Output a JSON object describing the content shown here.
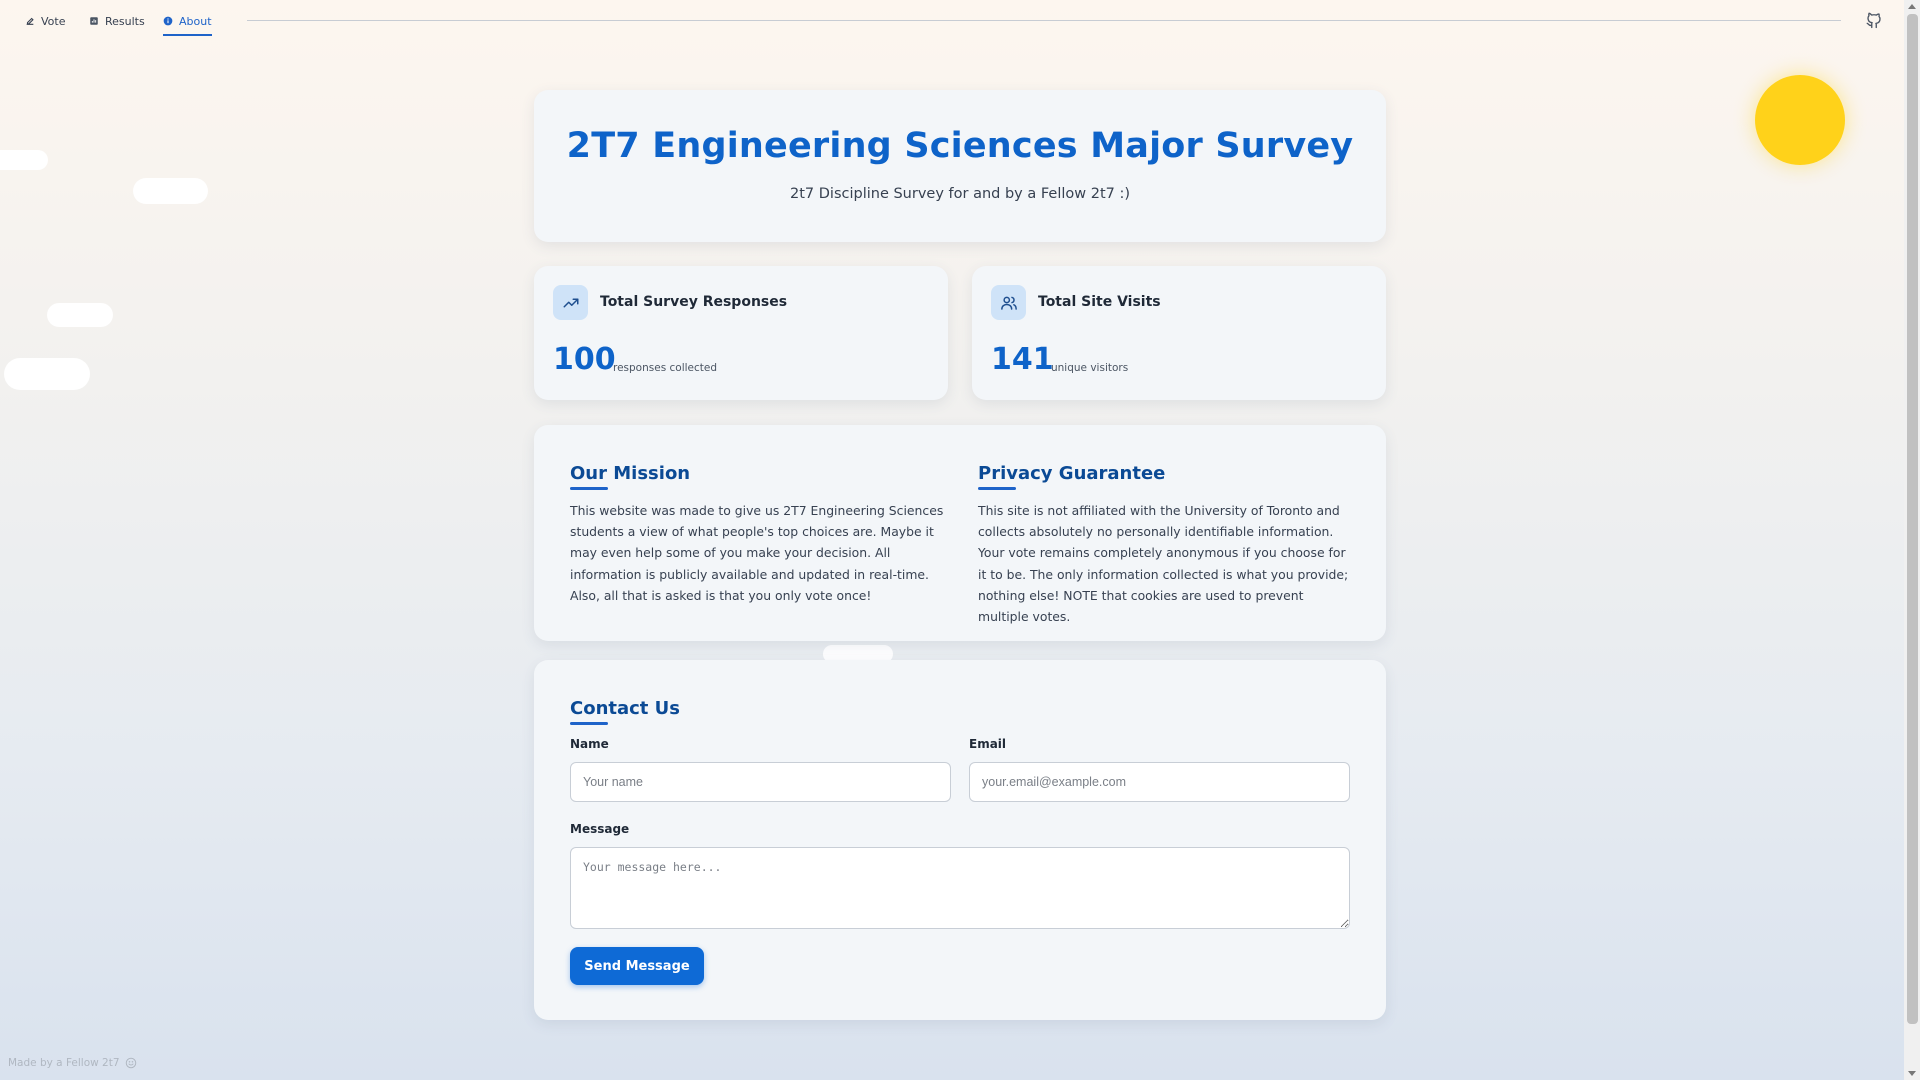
{
  "nav": {
    "items": [
      {
        "label": "Vote",
        "icon": "vote-icon",
        "active": false
      },
      {
        "label": "Results",
        "icon": "results-icon",
        "active": false
      },
      {
        "label": "About",
        "icon": "info-icon",
        "active": true
      }
    ],
    "github_icon": "github-icon"
  },
  "hero": {
    "title": "2T7 Engineering Sciences Major Survey",
    "subtitle": "2t7 Discipline Survey for and by a Fellow 2t7 :)"
  },
  "stats": {
    "responses": {
      "label": "Total Survey Responses",
      "value": "100",
      "unit": "responses collected",
      "icon": "trending-up-icon"
    },
    "visits": {
      "label": "Total Site Visits",
      "value": "141",
      "unit": "unique visitors",
      "icon": "users-icon"
    }
  },
  "mission": {
    "title": "Our Mission",
    "body": "This website was made to give us 2T7 Engineering Sciences students a view of what people's top choices are. Maybe it may even help some of you make your decision. All information is publicly available and updated in real-time. Also, all that is asked is that you only vote once!"
  },
  "privacy": {
    "title": "Privacy Guarantee",
    "body": "This site is not affiliated with the University of Toronto and collects absolutely no personally identifiable information. Your vote remains completely anonymous if you choose for it to be. The only information collected is what you provide; nothing else! NOTE that cookies are used to prevent multiple votes."
  },
  "contact": {
    "title": "Contact Us",
    "name_label": "Name",
    "name_placeholder": "Your name",
    "email_label": "Email",
    "email_placeholder": "your.email@example.com",
    "message_label": "Message",
    "message_placeholder": "Your message here...",
    "send_label": "Send Message"
  },
  "footer": {
    "text": "Made by a Fellow 2t7",
    "icon": "smile-icon"
  },
  "colors": {
    "accent": "#0e63c9",
    "sun": "#ffd21a",
    "button": "#0e6ad6"
  }
}
